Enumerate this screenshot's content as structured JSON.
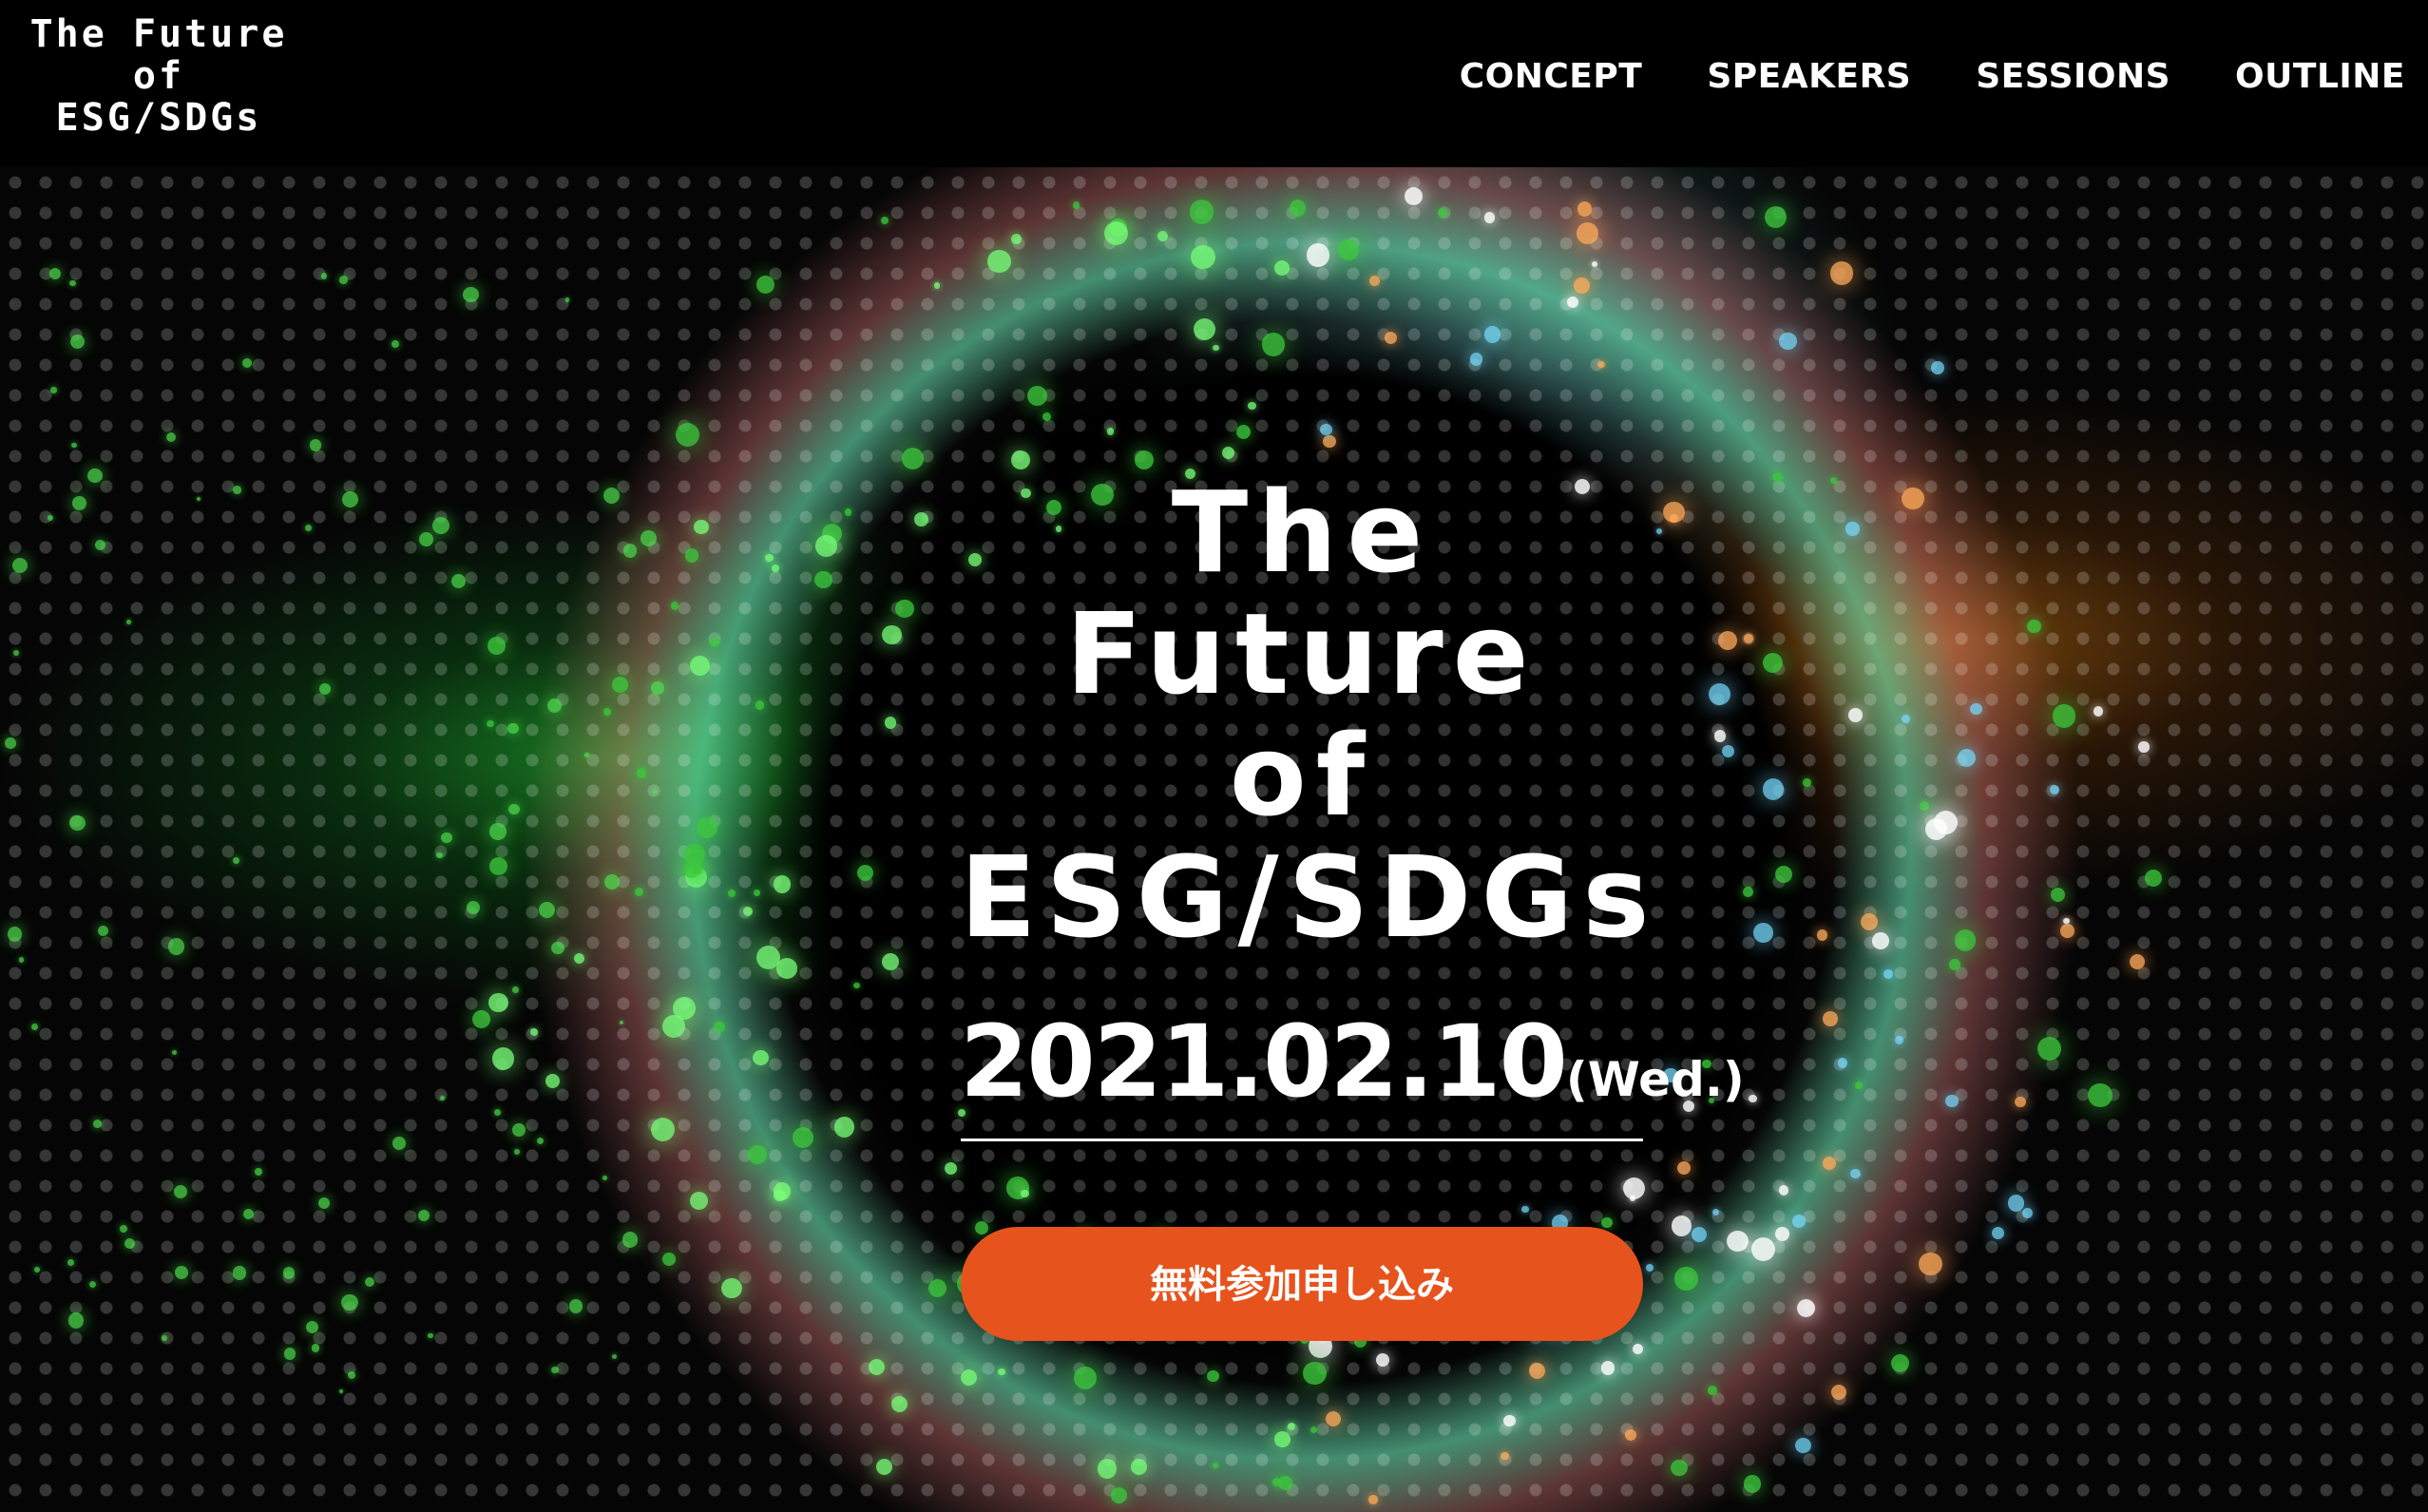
{
  "header": {
    "logo_lines": [
      "The Future",
      "of",
      "ESG/SDGs"
    ],
    "nav": [
      "CONCEPT",
      "SPEAKERS",
      "SESSIONS",
      "OUTLINE"
    ]
  },
  "hero": {
    "title_lines": [
      "The Future",
      "of",
      "ESG/SDGs"
    ],
    "date": "2021.02.10",
    "weekday": "(Wed.)",
    "cta_label": "無料参加申し込み"
  },
  "colors": {
    "cta": "#e6531d",
    "background": "#000000",
    "text": "#ffffff"
  }
}
